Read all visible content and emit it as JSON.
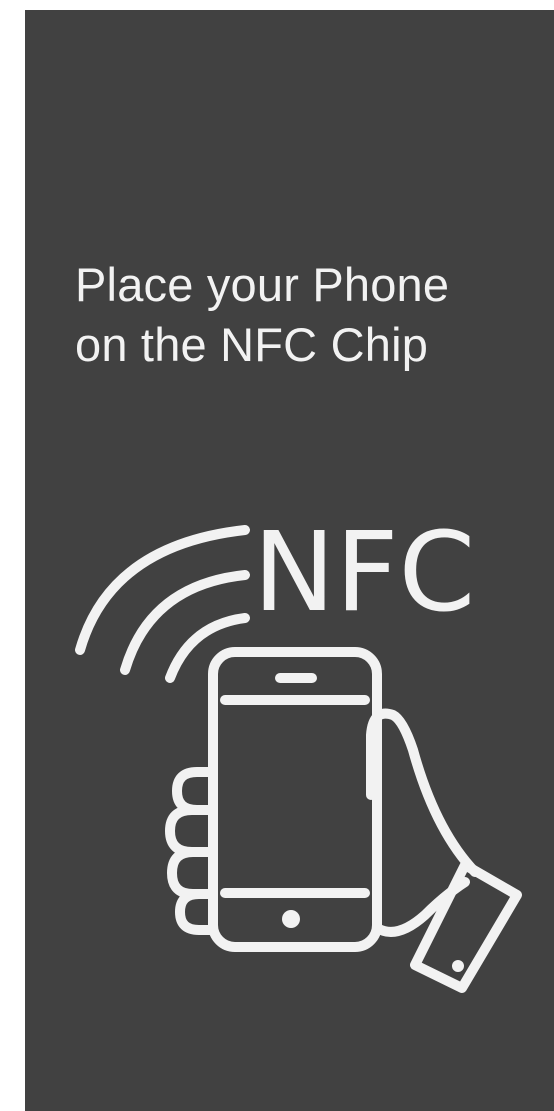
{
  "instruction": {
    "line1": "Place your Phone",
    "line2": "on the NFC Chip"
  },
  "graphic": {
    "label": "NFC",
    "icon": "hand-holding-phone-nfc-icon"
  },
  "colors": {
    "panel_background": "#414141",
    "foreground": "#f2f2f2",
    "page_background": "#ffffff"
  }
}
